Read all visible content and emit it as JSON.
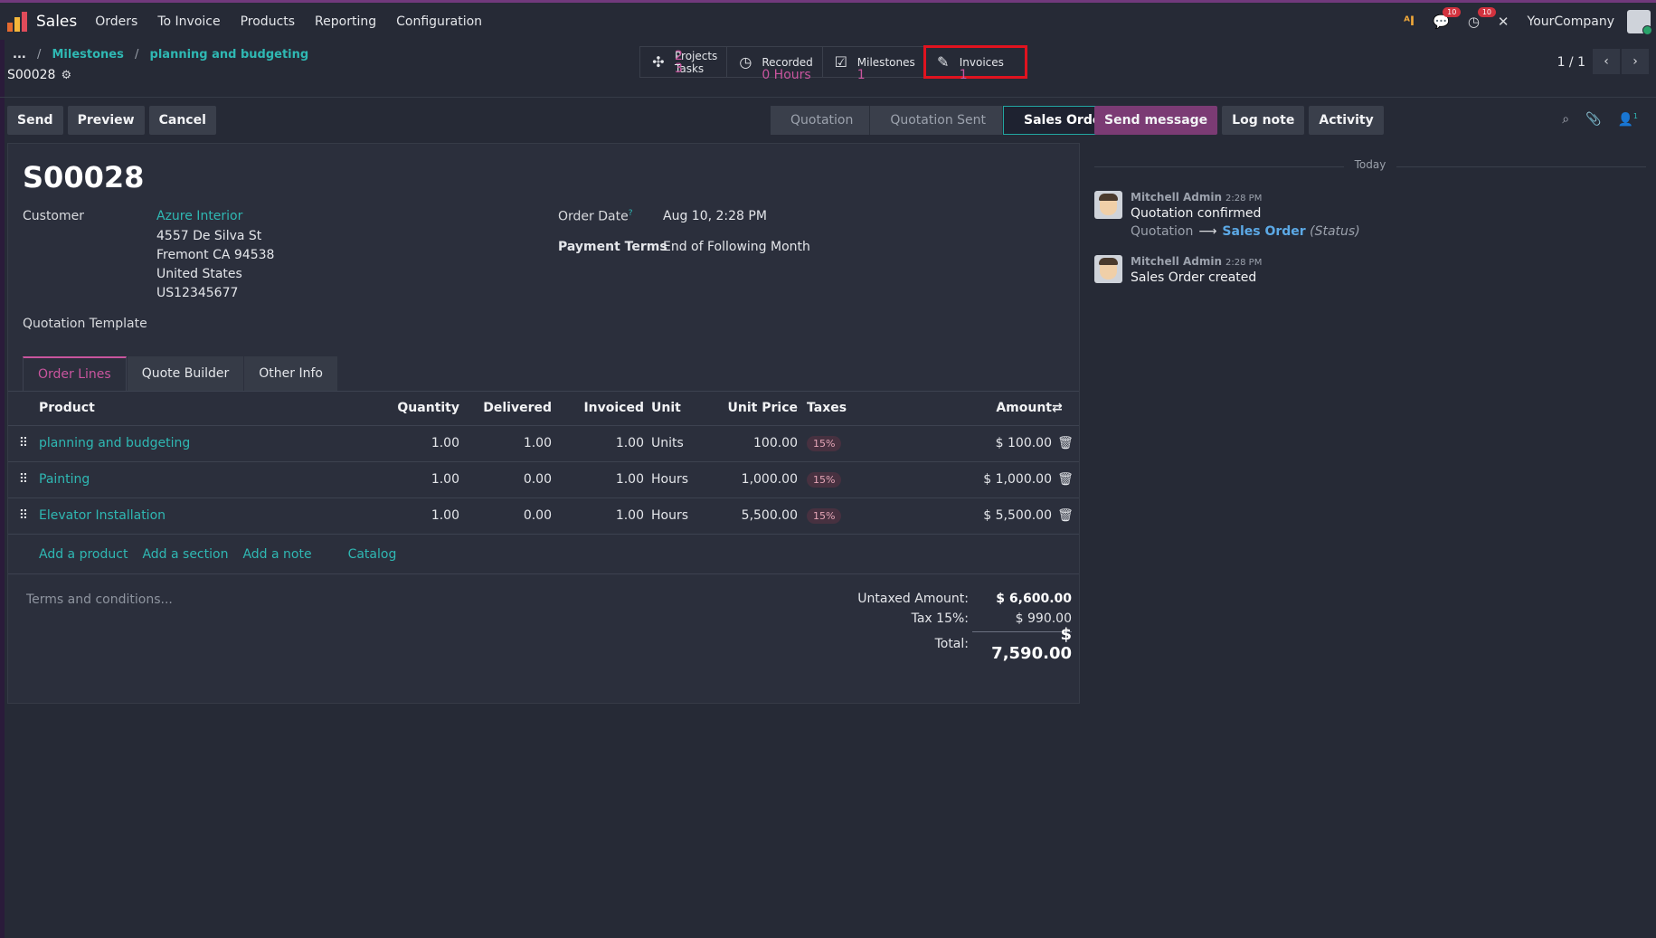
{
  "topbar": {
    "app_name": "Sales",
    "menu": [
      "Orders",
      "To Invoice",
      "Products",
      "Reporting",
      "Configuration"
    ],
    "chat_badge": "10",
    "activity_badge": "10",
    "company": "YourCompany"
  },
  "breadcrumb": {
    "ellipsis": "...",
    "items": [
      "Milestones",
      "planning and budgeting"
    ],
    "current": "S00028"
  },
  "smart_buttons": [
    {
      "value": "2",
      "label": "Projects",
      "value2": "3",
      "label2": "Tasks"
    },
    {
      "label": "Recorded",
      "value": "0 Hours"
    },
    {
      "label": "Milestones",
      "value": "1"
    },
    {
      "label": "Invoices",
      "value": "1"
    }
  ],
  "pager": {
    "text": "1 / 1"
  },
  "actions": {
    "send": "Send",
    "preview": "Preview",
    "cancel": "Cancel"
  },
  "status_steps": [
    "Quotation",
    "Quotation Sent",
    "Sales Order"
  ],
  "chatter_actions": {
    "send_message": "Send message",
    "log_note": "Log note",
    "activity": "Activity",
    "followers": "1"
  },
  "order": {
    "name": "S00028",
    "customer_label": "Customer",
    "customer_name": "Azure Interior",
    "address": [
      "4557 De Silva St",
      "Fremont CA 94538",
      "United States",
      "US12345677"
    ],
    "order_date_label": "Order Date",
    "help": "?",
    "order_date": "Aug 10, 2:28 PM",
    "payment_terms_label": "Payment Terms",
    "payment_terms": "End of Following Month",
    "template_label": "Quotation Template"
  },
  "tabs": [
    "Order Lines",
    "Quote Builder",
    "Other Info"
  ],
  "columns": {
    "product": "Product",
    "quantity": "Quantity",
    "delivered": "Delivered",
    "invoiced": "Invoiced",
    "unit": "Unit",
    "unit_price": "Unit Price",
    "taxes": "Taxes",
    "amount": "Amount"
  },
  "lines": [
    {
      "product": "planning and budgeting",
      "quantity": "1.00",
      "delivered": "1.00",
      "invoiced": "1.00",
      "unit": "Units",
      "unit_price": "100.00",
      "tax": "15%",
      "amount": "$ 100.00"
    },
    {
      "product": "Painting",
      "quantity": "1.00",
      "delivered": "0.00",
      "invoiced": "1.00",
      "unit": "Hours",
      "unit_price": "1,000.00",
      "tax": "15%",
      "amount": "$ 1,000.00"
    },
    {
      "product": "Elevator Installation",
      "quantity": "1.00",
      "delivered": "0.00",
      "invoiced": "1.00",
      "unit": "Hours",
      "unit_price": "5,500.00",
      "tax": "15%",
      "amount": "$ 5,500.00"
    }
  ],
  "add_links": {
    "product": "Add a product",
    "section": "Add a section",
    "note": "Add a note",
    "catalog": "Catalog"
  },
  "terms_placeholder": "Terms and conditions...",
  "totals": {
    "untaxed_label": "Untaxed Amount:",
    "untaxed": "$ 6,600.00",
    "tax_label": "Tax 15%:",
    "tax": "$ 990.00",
    "total_label": "Total:",
    "total": "$ 7,590.00"
  },
  "chatter": {
    "date_separator": "Today",
    "messages": [
      {
        "author": "Mitchell Admin",
        "time": "2:28 PM",
        "body": "Quotation confirmed",
        "from": "Quotation",
        "to": "Sales Order",
        "field": "(Status)"
      },
      {
        "author": "Mitchell Admin",
        "time": "2:28 PM",
        "body": "Sales Order created"
      }
    ]
  }
}
